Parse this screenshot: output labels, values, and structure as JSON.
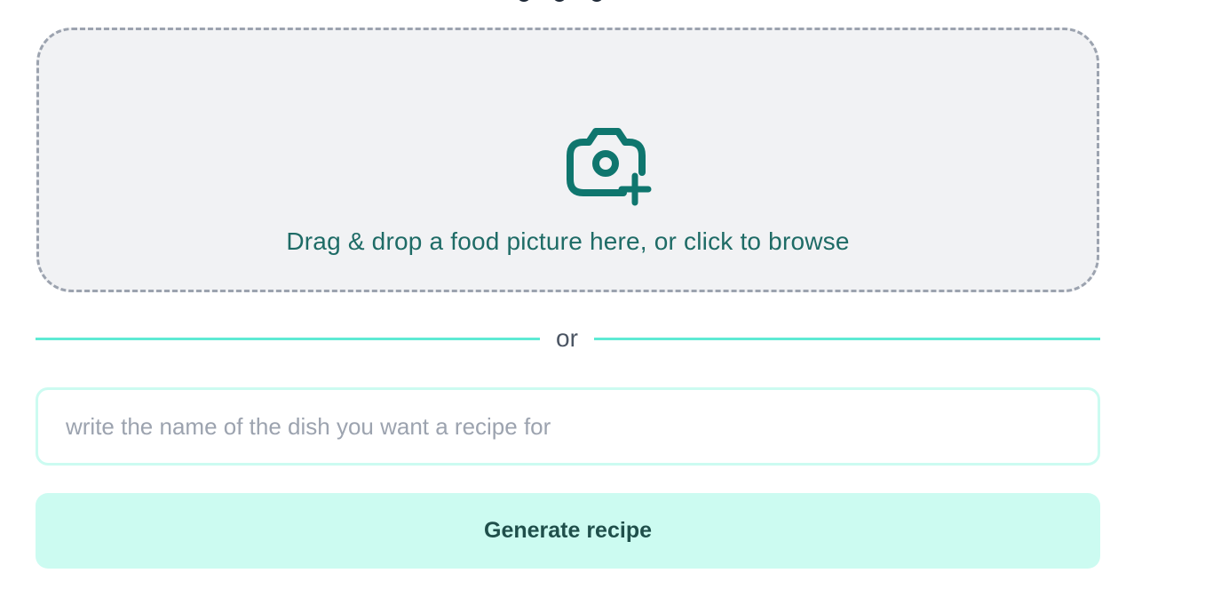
{
  "upload": {
    "icon": "camera-plus-icon",
    "prompt": "Drag & drop a food picture here, or click to browse"
  },
  "divider": {
    "label": "or"
  },
  "dish_input": {
    "placeholder": "write the name of the dish you want a recipe for",
    "value": ""
  },
  "generate_button": {
    "label": "Generate recipe"
  },
  "colors": {
    "accent": "#0f766e",
    "divider_line": "#5eead4",
    "button_bg": "#ccfbf1",
    "dropzone_bg": "#f1f2f4",
    "dropzone_border": "#9ca3af"
  }
}
